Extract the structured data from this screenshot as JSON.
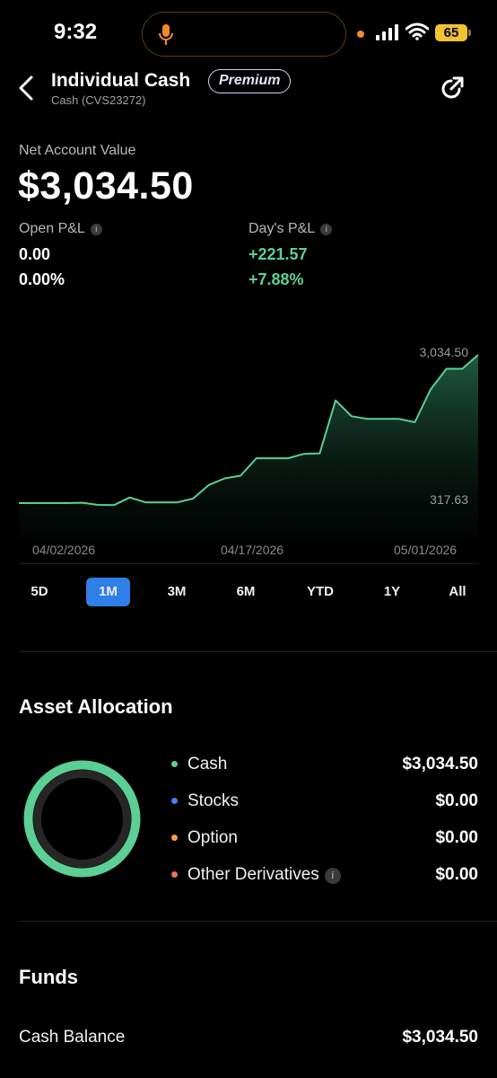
{
  "status_bar": {
    "time": "9:32",
    "battery": "65",
    "icons": [
      "mic-icon",
      "signal-icon",
      "wifi-icon",
      "battery-icon"
    ]
  },
  "header": {
    "title": "Individual Cash",
    "badge": "Premium",
    "subtitle": "Cash (CVS23272)",
    "icons": [
      "chevron-left-icon",
      "share-icon"
    ]
  },
  "summary": {
    "net_label": "Net Account Value",
    "net_value": "$3,034.50",
    "open_pl": {
      "label": "Open P&L",
      "amount": "0.00",
      "percent": "0.00%"
    },
    "day_pl": {
      "label": "Day's P&L",
      "amount": "+221.57",
      "percent": "+7.88%"
    },
    "info_glyph": "i"
  },
  "chart_data": {
    "type": "area",
    "max_label": "3,034.50",
    "min_label": "317.63",
    "x_ticks": [
      "04/02/2026",
      "04/17/2026",
      "05/01/2026"
    ],
    "ylim": [
      317.63,
      3034.5
    ],
    "values": [
      317.63,
      317.63,
      317.63,
      317.63,
      325,
      285,
      280,
      420,
      330,
      330,
      330,
      400,
      650,
      770,
      820,
      1140,
      1140,
      1140,
      1220,
      1230,
      2200,
      1910,
      1860,
      1860,
      1860,
      1800,
      2400,
      2780,
      2780,
      3034.5
    ],
    "line_color": "#5ccf94"
  },
  "range_tabs": [
    {
      "label": "5D",
      "active": false
    },
    {
      "label": "1M",
      "active": true
    },
    {
      "label": "3M",
      "active": false
    },
    {
      "label": "6M",
      "active": false
    },
    {
      "label": "YTD",
      "active": false
    },
    {
      "label": "1Y",
      "active": false
    },
    {
      "label": "All",
      "active": false
    }
  ],
  "allocation": {
    "title": "Asset Allocation",
    "items": [
      {
        "label": "Cash",
        "value": "$3,034.50",
        "color": "#5ccf94",
        "share": 1.0
      },
      {
        "label": "Stocks",
        "value": "$0.00",
        "color": "#4a7ff0",
        "share": 0
      },
      {
        "label": "Option",
        "value": "$0.00",
        "color": "#f0a040",
        "share": 0
      },
      {
        "label": "Other Derivatives",
        "value": "$0.00",
        "color": "#e8745a",
        "share": 0
      }
    ]
  },
  "funds": {
    "title": "Funds",
    "cash_balance_label": "Cash Balance",
    "cash_balance_value": "$3,034.50"
  },
  "colors": {
    "accent": "#2f7fe8",
    "positive": "#5ccf94",
    "background": "#000000"
  }
}
